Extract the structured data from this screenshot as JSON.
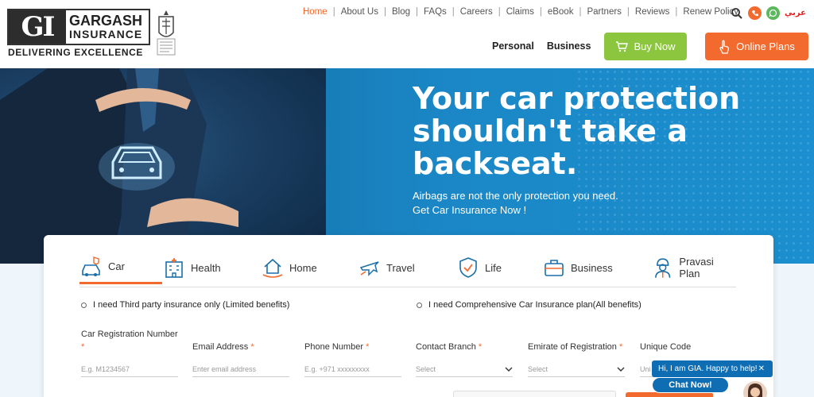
{
  "brand": {
    "logo_mark": "GI",
    "name_line1": "GARGASH",
    "name_line2": "INSURANCE",
    "tagline": "DELIVERING EXCELLENCE"
  },
  "topnav": {
    "items": [
      "Home",
      "About Us",
      "Blog",
      "FAQs",
      "Careers",
      "Claims",
      "eBook",
      "Partners",
      "Reviews",
      "Renew Policy"
    ],
    "active": "Home",
    "language_link": "عربي"
  },
  "mainnav": {
    "personal": "Personal",
    "business": "Business",
    "buy_now": "Buy Now",
    "online_plans": "Online Plans"
  },
  "hero": {
    "title": "Your car protection shouldn't take a backseat.",
    "subtitle_line1": "Airbags are not the only protection you need.",
    "subtitle_line2": "Get Car Insurance Now !"
  },
  "tabs": [
    {
      "label": "Car",
      "icon": "car-icon",
      "active": true
    },
    {
      "label": "Health",
      "icon": "hospital-icon",
      "active": false
    },
    {
      "label": "Home",
      "icon": "home-icon",
      "active": false
    },
    {
      "label": "Travel",
      "icon": "airplane-icon",
      "active": false
    },
    {
      "label": "Life",
      "icon": "shield-check-icon",
      "active": false
    },
    {
      "label": "Business",
      "icon": "briefcase-icon",
      "active": false
    },
    {
      "label": "Pravasi Plan",
      "icon": "worker-icon",
      "active": false
    }
  ],
  "options": {
    "third_party": "I need Third party insurance only (Limited benefits)",
    "comprehensive": "I need Comprehensive Car Insurance plan(All benefits)"
  },
  "fields": {
    "car_reg": {
      "label": "Car Registration Number",
      "placeholder": "E.g. M1234567"
    },
    "email": {
      "label": "Email Address",
      "placeholder": "Enter email address"
    },
    "phone": {
      "label": "Phone Number",
      "placeholder": "E.g. +971 xxxxxxxxx"
    },
    "branch": {
      "label": "Contact Branch",
      "value": "Select"
    },
    "emirate": {
      "label": "Emirate of Registration",
      "value": "Select"
    },
    "unique_code": {
      "label": "Unique Code",
      "placeholder": "Uni"
    }
  },
  "chat": {
    "greeting": "Hi, I am GIA. Happy to help!",
    "button": "Chat Now!"
  },
  "colors": {
    "accent_orange": "#f26a2e",
    "accent_green": "#8cc63f",
    "hero_blue": "#1b87c6"
  }
}
